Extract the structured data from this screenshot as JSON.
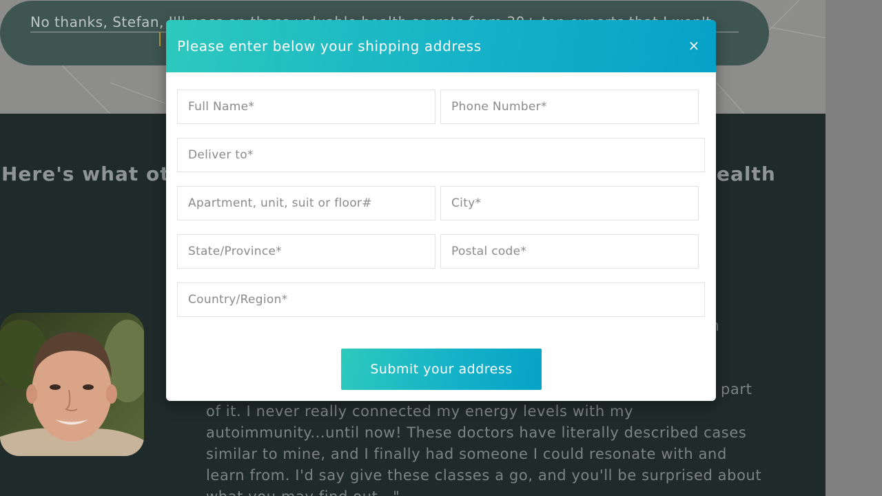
{
  "background": {
    "no_thanks_text": "No thanks, Stefan, I'll pass on these valuable health secrets from 30+ top experts that I won't",
    "heading_left": "Here's what ot",
    "heading_right": "ealth",
    "stray_char": "n",
    "part_word": "part",
    "testimonial_lines": [
      "of it. I never really connected my energy levels with my",
      "autoimmunity...until now! These doctors have literally described cases",
      "similar to mine, and I finally had someone I could resonate with and",
      "learn from. I'd say give these classes a go, and you'll be surprised about",
      "what you may find out...\""
    ]
  },
  "modal": {
    "title": "Please enter below your shipping address",
    "close_glyph": "×",
    "fields": {
      "full_name": {
        "placeholder": "Full Name*",
        "value": ""
      },
      "phone": {
        "placeholder": "Phone Number*",
        "value": ""
      },
      "deliver_to": {
        "placeholder": "Deliver to*",
        "value": ""
      },
      "apartment": {
        "placeholder": "Apartment, unit, suit or floor#",
        "value": ""
      },
      "city": {
        "placeholder": "City*",
        "value": ""
      },
      "state": {
        "placeholder": "State/Province*",
        "value": ""
      },
      "postal": {
        "placeholder": "Postal code*",
        "value": ""
      },
      "country": {
        "placeholder": "Country/Region*",
        "value": ""
      }
    },
    "submit_label": "Submit your address"
  },
  "colors": {
    "accent_gradient_start": "#2ec9bd",
    "accent_gradient_end": "#05a2c7",
    "dark_section": "#1f2a2a",
    "overlay_pill": "#3f5551"
  },
  "icons": {
    "close": "close-icon"
  }
}
